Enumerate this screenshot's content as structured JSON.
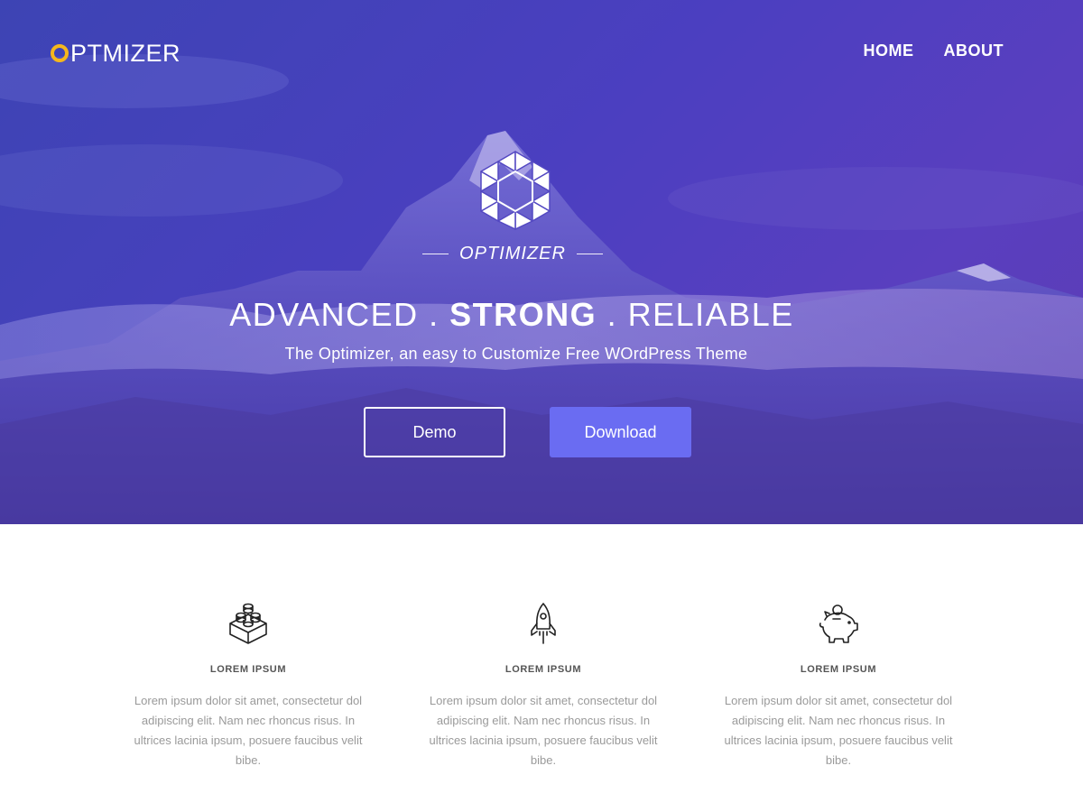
{
  "header": {
    "logo_first_letter": "O",
    "logo_rest": "PTMIZER",
    "nav": [
      {
        "label": "HOME"
      },
      {
        "label": "ABOUT"
      }
    ]
  },
  "hero": {
    "brand_name": "OPTIMIZER",
    "headline_part1": "ADVANCED . ",
    "headline_strong": "STRONG",
    "headline_part2": " . RELIABLE",
    "tagline": "The Optimizer, an easy to Customize Free WOrdPress Theme",
    "demo_label": "Demo",
    "download_label": "Download"
  },
  "features": [
    {
      "icon": "lego-block-icon",
      "title": "LOREM IPSUM",
      "text": "Lorem ipsum dolor sit amet, consectetur dol adipiscing elit. Nam nec rhoncus risus. In ultrices lacinia ipsum, posuere faucibus velit bibe."
    },
    {
      "icon": "rocket-icon",
      "title": "LOREM IPSUM",
      "text": "Lorem ipsum dolor sit amet, consectetur dol adipiscing elit. Nam nec rhoncus risus. In ultrices lacinia ipsum, posuere faucibus velit bibe."
    },
    {
      "icon": "piggy-bank-icon",
      "title": "LOREM IPSUM",
      "text": "Lorem ipsum dolor sit amet, consectetur dol adipiscing elit. Nam nec rhoncus risus. In ultrices lacinia ipsum, posuere faucibus velit bibe."
    }
  ],
  "colors": {
    "logo_accent": "#f5b71c",
    "hero_overlay": "#4a3fc0",
    "download_button": "#6a6cf2",
    "feature_text": "#9a9a9a",
    "feature_title": "#555555"
  }
}
